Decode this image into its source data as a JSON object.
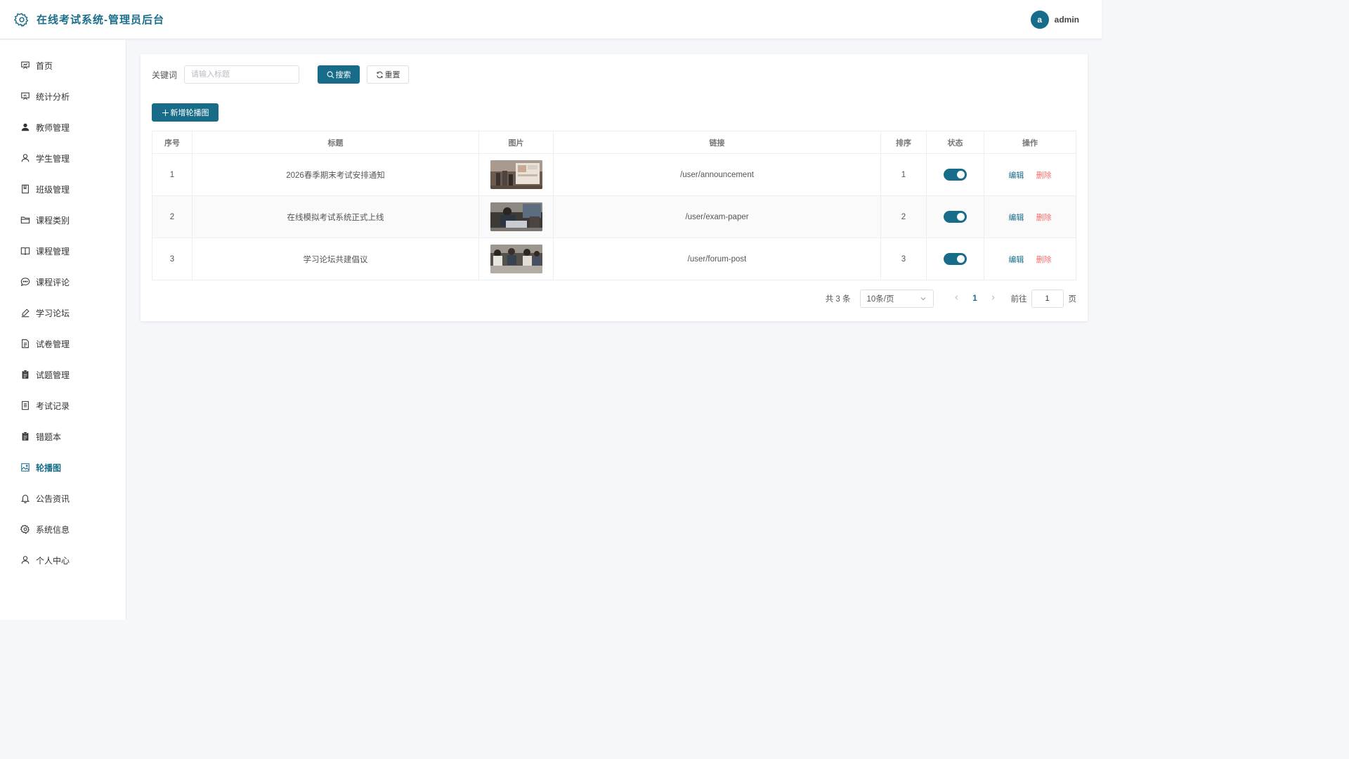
{
  "header": {
    "title": "在线考试系统-管理员后台",
    "avatar_letter": "a",
    "username": "admin"
  },
  "sidebar": {
    "active_index": 13,
    "items": [
      {
        "label": "首页",
        "icon": "dashboard-icon"
      },
      {
        "label": "统计分析",
        "icon": "chart-icon"
      },
      {
        "label": "教师管理",
        "icon": "user-filled-icon"
      },
      {
        "label": "学生管理",
        "icon": "user-icon"
      },
      {
        "label": "班级管理",
        "icon": "notebook-icon"
      },
      {
        "label": "课程类别",
        "icon": "folder-icon"
      },
      {
        "label": "课程管理",
        "icon": "book-icon"
      },
      {
        "label": "课程评论",
        "icon": "chat-icon"
      },
      {
        "label": "学习论坛",
        "icon": "edit-pen-icon"
      },
      {
        "label": "试卷管理",
        "icon": "document-icon"
      },
      {
        "label": "试题管理",
        "icon": "clipboard-icon"
      },
      {
        "label": "考试记录",
        "icon": "tickets-icon"
      },
      {
        "label": "错题本",
        "icon": "clipboard-icon"
      },
      {
        "label": "轮播图",
        "icon": "picture-icon"
      },
      {
        "label": "公告资讯",
        "icon": "bell-icon"
      },
      {
        "label": "系统信息",
        "icon": "gear-icon"
      },
      {
        "label": "个人中心",
        "icon": "user-icon"
      }
    ]
  },
  "search": {
    "label": "关键词",
    "placeholder": "请输入标题",
    "value": "",
    "search_button": "搜索",
    "reset_button": "重置"
  },
  "actions": {
    "add_button": "新增轮播图"
  },
  "table": {
    "columns": [
      "序号",
      "标题",
      "图片",
      "链接",
      "排序",
      "状态",
      "操作"
    ],
    "rows": [
      {
        "index": "1",
        "title": "2026春季期末考试安排通知",
        "link": "/user/announcement",
        "sort": "1",
        "status": true
      },
      {
        "index": "2",
        "title": "在线模拟考试系统正式上线",
        "link": "/user/exam-paper",
        "sort": "2",
        "status": true
      },
      {
        "index": "3",
        "title": "学习论坛共建倡议",
        "link": "/user/forum-post",
        "sort": "3",
        "status": true
      }
    ],
    "edit_label": "编辑",
    "delete_label": "删除"
  },
  "pagination": {
    "total_text": "共 3 条",
    "page_size": "10条/页",
    "current_page": "1",
    "goto_label": "前往",
    "goto_value": "1",
    "goto_suffix": "页"
  },
  "colors": {
    "primary": "#176d89",
    "danger": "#f56c6c"
  }
}
